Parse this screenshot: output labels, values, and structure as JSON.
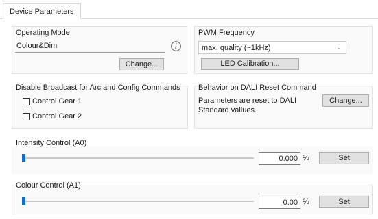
{
  "tabs": [
    {
      "label": "Device Parameters"
    }
  ],
  "operating_mode": {
    "title": "Operating Mode",
    "value": "Colour&Dim",
    "info_icon": "info-icon",
    "change_label": "Change..."
  },
  "pwm": {
    "title": "PWM Frequency",
    "selected": "max. quality (~1kHz)",
    "calibration_label": "LED Calibration..."
  },
  "broadcast": {
    "title": "Disable Broadcast for Arc and Config Commands",
    "options": [
      {
        "label": "Control Gear 1",
        "checked": false
      },
      {
        "label": "Control Gear 2",
        "checked": false
      }
    ]
  },
  "reset": {
    "title": "Behavior on DALI Reset Command",
    "text_line1": "Parameters are reset to DALI",
    "text_line2": "Standard vallues.",
    "change_label": "Change..."
  },
  "intensity": {
    "title": "Intensity Control (A0)",
    "value": "0.000",
    "unit": "%",
    "level": 0,
    "set_label": "Set"
  },
  "colour": {
    "title": "Colour Control (A1)",
    "value": "0.00",
    "unit": "%",
    "level": 0,
    "set_label": "Set"
  },
  "colors": {
    "accent": "#0f6ecd",
    "group_bg": "#f9f9f9",
    "button_bg": "#e1e1e1"
  }
}
